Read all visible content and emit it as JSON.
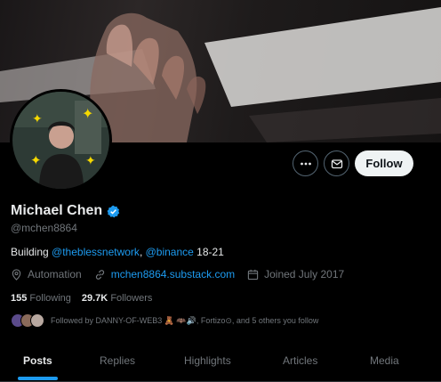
{
  "profile": {
    "name": "Michael Chen",
    "handle": "@mchen8864",
    "bio_prefix": "Building ",
    "bio_link1": "@theblessnetwork",
    "bio_sep": ", ",
    "bio_link2": "@binance",
    "bio_suffix": " 18-21",
    "location": "Automation",
    "website": "mchen8864.substack.com",
    "joined": "Joined July 2017",
    "following_count": "155",
    "following_label": "Following",
    "followers_count": "29.7K",
    "followers_label": "Followers",
    "followed_by": "Followed by DANNY-OF-WEB3 🧸 🦇🔊, Fortizo⊙, and 5 others you follow"
  },
  "actions": {
    "follow_label": "Follow"
  },
  "tabs": [
    {
      "label": "Posts",
      "active": true
    },
    {
      "label": "Replies"
    },
    {
      "label": "Highlights"
    },
    {
      "label": "Articles"
    },
    {
      "label": "Media"
    }
  ],
  "colors": {
    "accent": "#1d9bf0",
    "background": "#000000",
    "text": "#e7e9ea",
    "muted": "#71767b"
  }
}
